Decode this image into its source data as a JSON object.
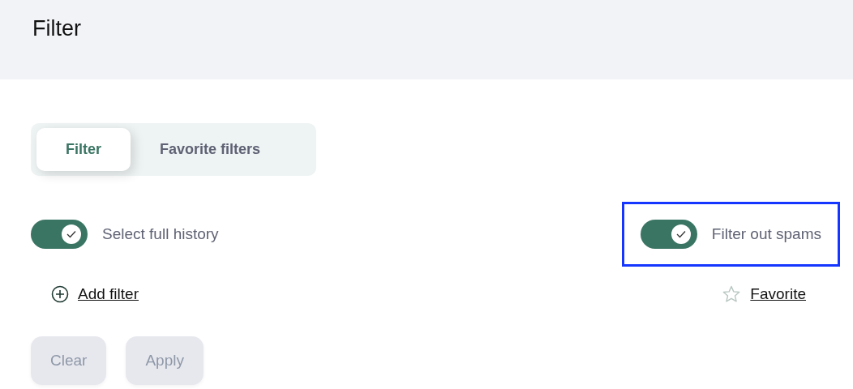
{
  "header": {
    "title": "Filter"
  },
  "tabs": [
    {
      "label": "Filter",
      "selected": true
    },
    {
      "label": "Favorite filters",
      "selected": false
    }
  ],
  "toggles": [
    {
      "label": "Select full history",
      "on": true,
      "highlighted": false
    },
    {
      "label": "Filter out spams",
      "on": true,
      "highlighted": true
    }
  ],
  "links": [
    {
      "kind": "add",
      "label": "Add filter"
    },
    {
      "kind": "favorite",
      "label": "Favorite"
    }
  ],
  "buttons": [
    {
      "label": "Clear",
      "disabled": true
    },
    {
      "label": "Apply",
      "disabled": true
    }
  ]
}
